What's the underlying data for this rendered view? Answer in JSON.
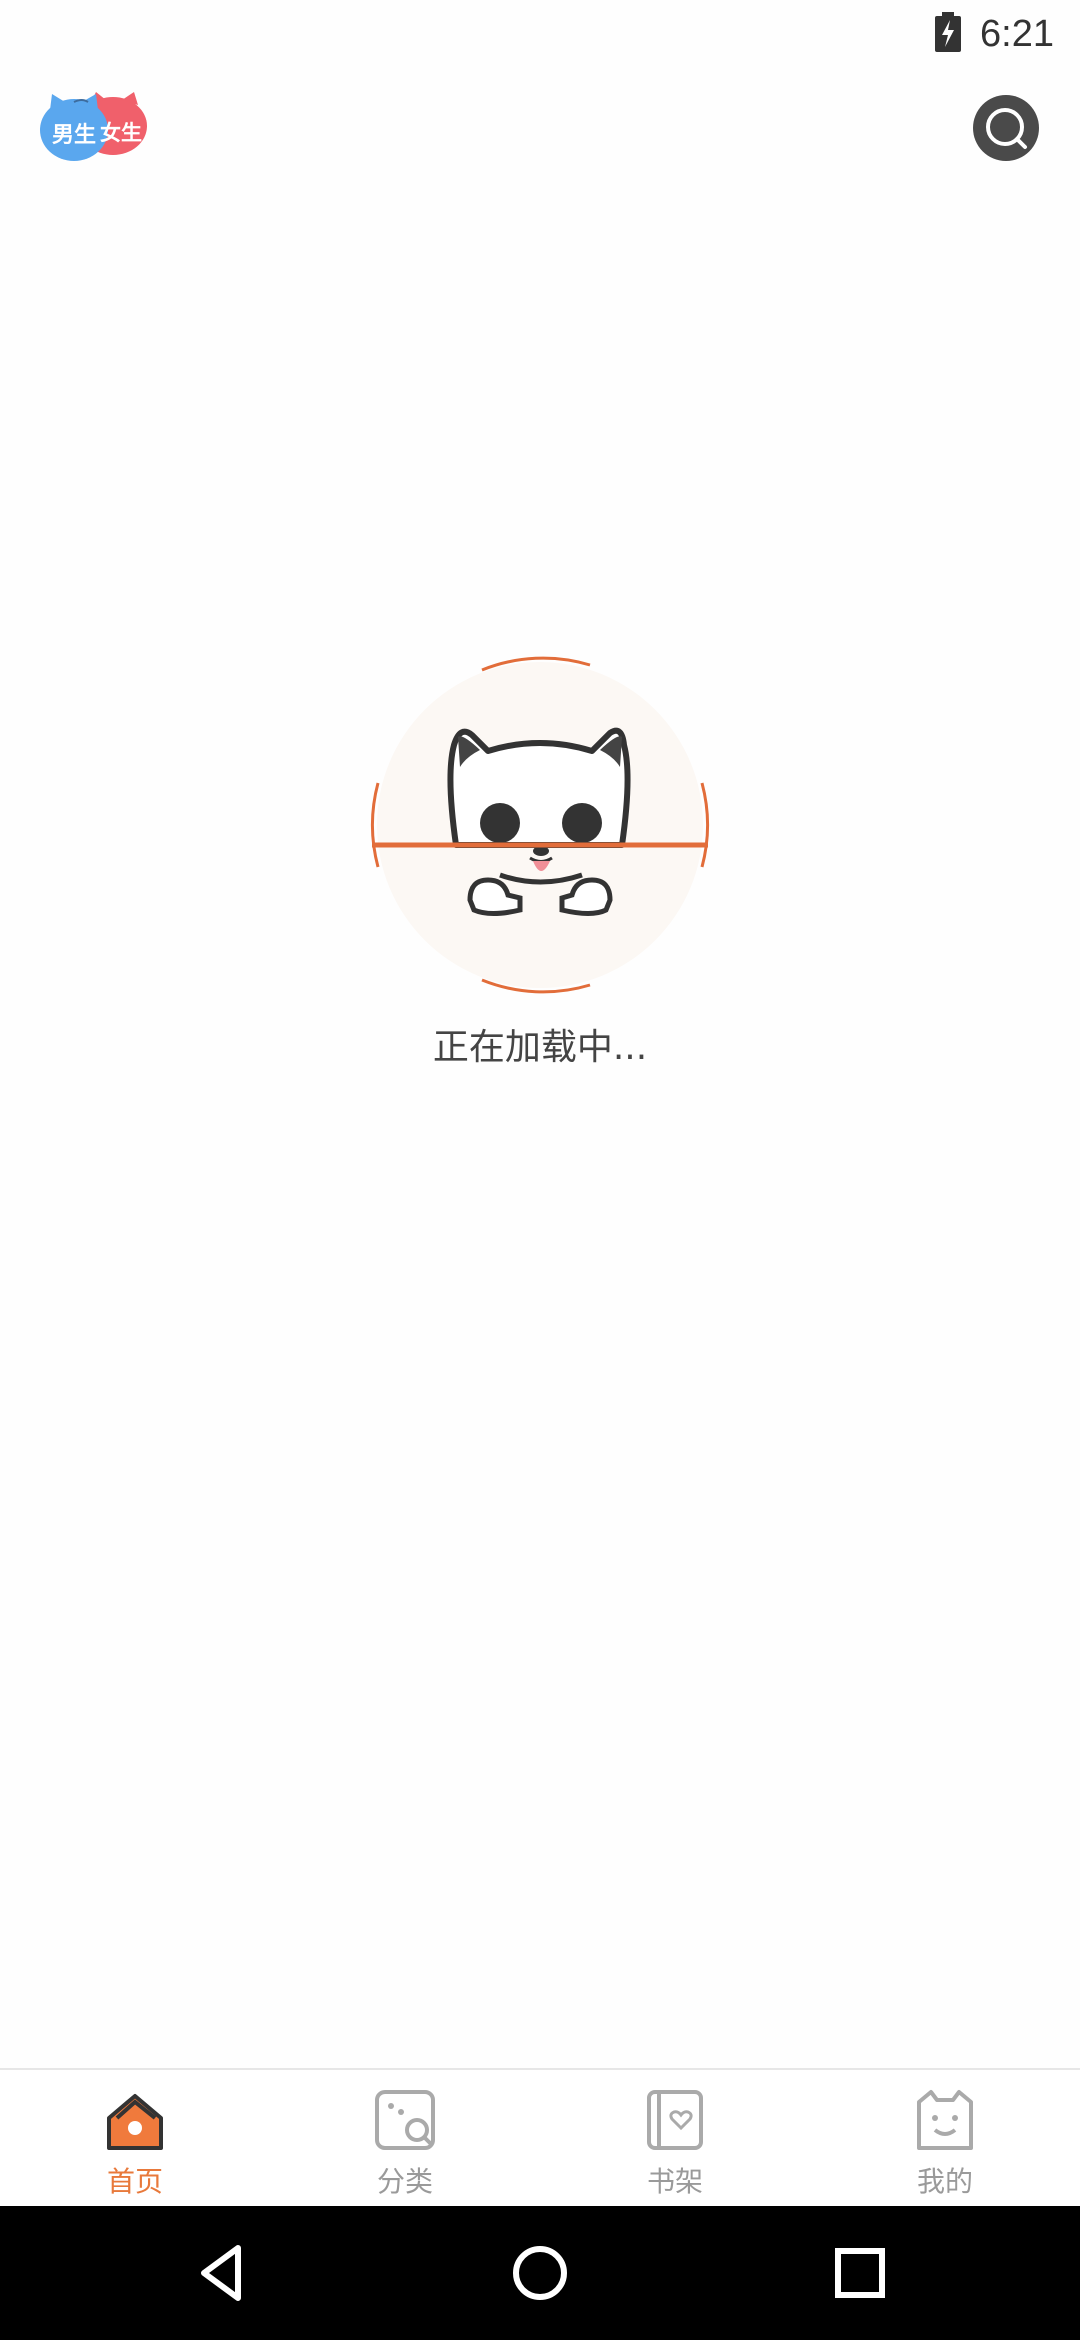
{
  "status_bar": {
    "time": "6:21",
    "battery_icon": "battery-charging-icon"
  },
  "header": {
    "gender_switch": {
      "male_label": "男生",
      "female_label": "女生",
      "male_color": "#5aa7ee",
      "female_color": "#f0606b"
    },
    "search_icon": "search-icon"
  },
  "loading": {
    "text": "正在加载中...",
    "accent_color": "#e26d3a",
    "illustration": "cat-mascot"
  },
  "tab_bar": {
    "active_color": "#e8793b",
    "inactive_color": "#9a9a9a",
    "tabs": [
      {
        "label": "首页",
        "icon": "home-icon",
        "active": true
      },
      {
        "label": "分类",
        "icon": "category-icon",
        "active": false
      },
      {
        "label": "书架",
        "icon": "bookshelf-icon",
        "active": false
      },
      {
        "label": "我的",
        "icon": "profile-icon",
        "active": false
      }
    ]
  },
  "nav_bar": {
    "back_icon": "back-icon",
    "home_icon": "home-circle-icon",
    "recents_icon": "recents-icon"
  }
}
